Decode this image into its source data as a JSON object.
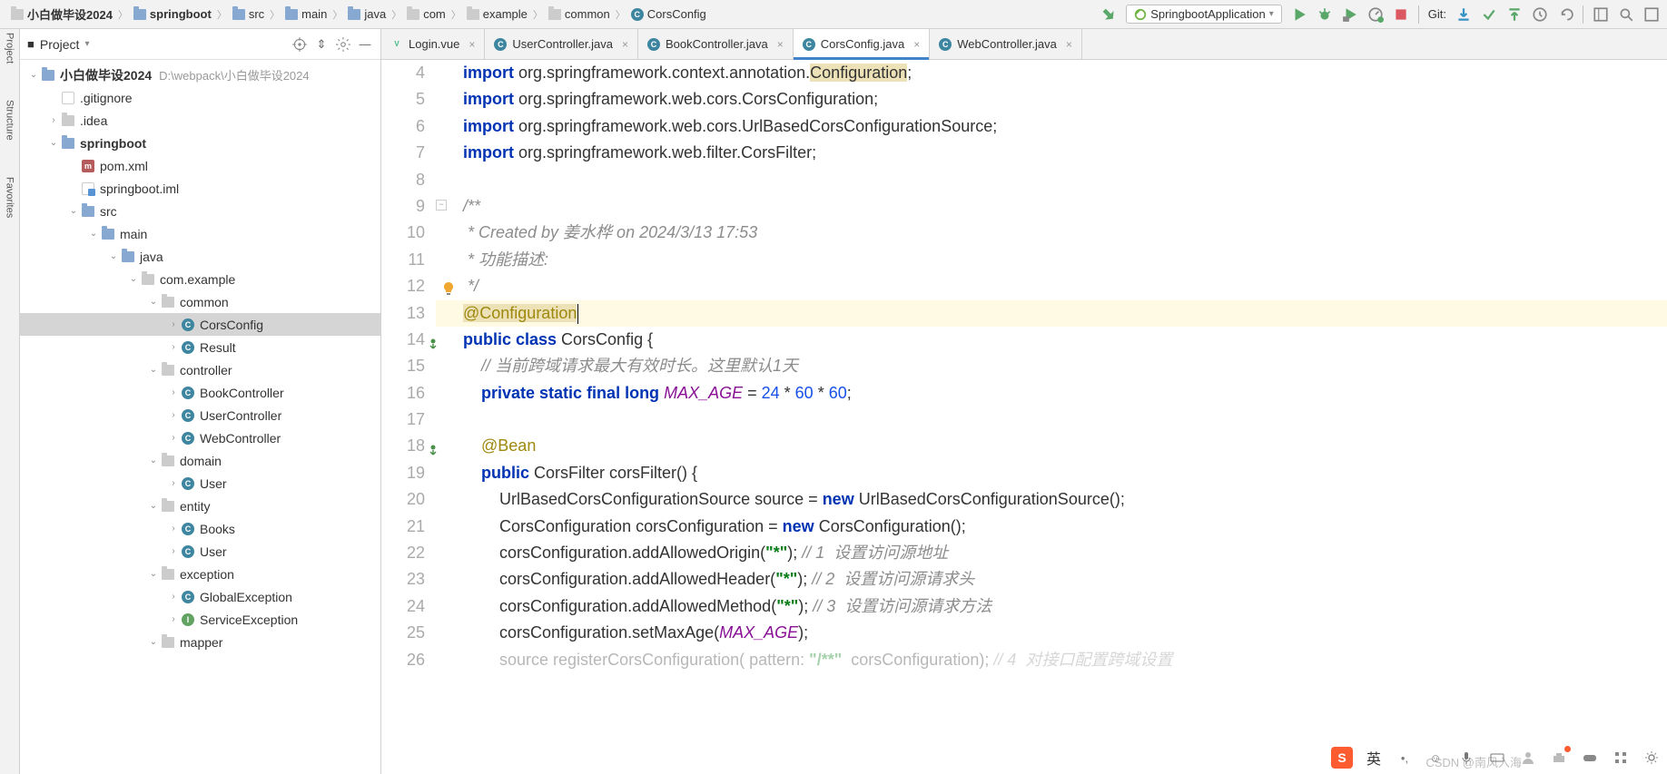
{
  "breadcrumbs": [
    "小白做毕设2024",
    "springboot",
    "src",
    "main",
    "java",
    "com",
    "example",
    "common",
    "CorsConfig"
  ],
  "run_config": "SpringbootApplication",
  "git_label": "Git:",
  "project_header": {
    "title": "Project"
  },
  "project_tree": {
    "root": {
      "name": "小白做毕设2024",
      "path": "D:\\webpack\\小白做毕设2024"
    },
    "items": [
      {
        "name": ".gitignore"
      },
      {
        "name": ".idea"
      },
      {
        "name": "springboot"
      },
      {
        "name": "pom.xml"
      },
      {
        "name": "springboot.iml"
      },
      {
        "name": "src"
      },
      {
        "name": "main"
      },
      {
        "name": "java"
      },
      {
        "name": "com.example"
      },
      {
        "name": "common"
      },
      {
        "name": "CorsConfig"
      },
      {
        "name": "Result"
      },
      {
        "name": "controller"
      },
      {
        "name": "BookController"
      },
      {
        "name": "UserController"
      },
      {
        "name": "WebController"
      },
      {
        "name": "domain"
      },
      {
        "name": "User"
      },
      {
        "name": "entity"
      },
      {
        "name": "Books"
      },
      {
        "name": "User"
      },
      {
        "name": "exception"
      },
      {
        "name": "GlobalException"
      },
      {
        "name": "ServiceException"
      },
      {
        "name": "mapper"
      }
    ]
  },
  "editor_tabs": [
    {
      "label": "Login.vue",
      "type": "vue"
    },
    {
      "label": "UserController.java",
      "type": "class"
    },
    {
      "label": "BookController.java",
      "type": "class"
    },
    {
      "label": "CorsConfig.java",
      "type": "class",
      "active": true
    },
    {
      "label": "WebController.java",
      "type": "class"
    }
  ],
  "code": {
    "lines": [
      {
        "n": 4,
        "html": "<span class='kw'>import</span> org.springframework.context.annotation.<span class='ann-hl'>Configuration</span>;"
      },
      {
        "n": 5,
        "html": "<span class='kw'>import</span> org.springframework.web.cors.CorsConfiguration;"
      },
      {
        "n": 6,
        "html": "<span class='kw'>import</span> org.springframework.web.cors.UrlBasedCorsConfigurationSource;"
      },
      {
        "n": 7,
        "html": "<span class='kw'>import</span> org.springframework.web.filter.CorsFilter;"
      },
      {
        "n": 8,
        "html": ""
      },
      {
        "n": 9,
        "html": "<span class='cmt'>/**</span>",
        "fold": "-"
      },
      {
        "n": 10,
        "html": "<span class='cmt'> * Created by 姜水桦 on 2024/3/13 17:53</span>"
      },
      {
        "n": 11,
        "html": "<span class='cmt'> * 功能描述:</span>"
      },
      {
        "n": 12,
        "html": "<span class='cmt'> */</span>",
        "bulb": true
      },
      {
        "n": 13,
        "html": "<span class='ann ann-hl'>@Configuration</span><span class='caret'></span>",
        "hl": true
      },
      {
        "n": 14,
        "html": "<span class='kw'>public class</span> CorsConfig {",
        "mark": "impl"
      },
      {
        "n": 15,
        "html": "    <span class='cmt'>// 当前跨域请求最大有效时长。这里默认1天</span>"
      },
      {
        "n": 16,
        "html": "    <span class='kw'>private static final long</span> <span class='const'>MAX_AGE</span> = <span class='num'>24</span> * <span class='num'>60</span> * <span class='num'>60</span>;"
      },
      {
        "n": 17,
        "html": ""
      },
      {
        "n": 18,
        "html": "    <span class='ann'>@Bean</span>",
        "mark": "impl"
      },
      {
        "n": 19,
        "html": "    <span class='kw'>public</span> CorsFilter corsFilter() {"
      },
      {
        "n": 20,
        "html": "        UrlBasedCorsConfigurationSource source = <span class='kw'>new</span> UrlBasedCorsConfigurationSource();"
      },
      {
        "n": 21,
        "html": "        CorsConfiguration corsConfiguration = <span class='kw'>new</span> CorsConfiguration();"
      },
      {
        "n": 22,
        "html": "        corsConfiguration.addAllowedOrigin(<span class='str'>\"*\"</span>); <span class='cmt'>// 1  设置访问源地址</span>"
      },
      {
        "n": 23,
        "html": "        corsConfiguration.addAllowedHeader(<span class='str'>\"*\"</span>); <span class='cmt'>// 2  设置访问源请求头</span>"
      },
      {
        "n": 24,
        "html": "        corsConfiguration.addAllowedMethod(<span class='str'>\"*\"</span>); <span class='cmt'>// 3  设置访问源请求方法</span>"
      },
      {
        "n": 25,
        "html": "        corsConfiguration.setMaxAge(<span class='const'>MAX_AGE</span>);"
      },
      {
        "n": 26,
        "html": "        <span style='opacity:.35'>source registerCorsConfiguration( pattern: <span class='str'>\"/**\"</span>  corsConfiguration); <span class='cmt'>// 4  对接口配置跨域设置</span></span>"
      }
    ]
  },
  "ime_label": "英",
  "watermark": "CSDN @南风入海"
}
